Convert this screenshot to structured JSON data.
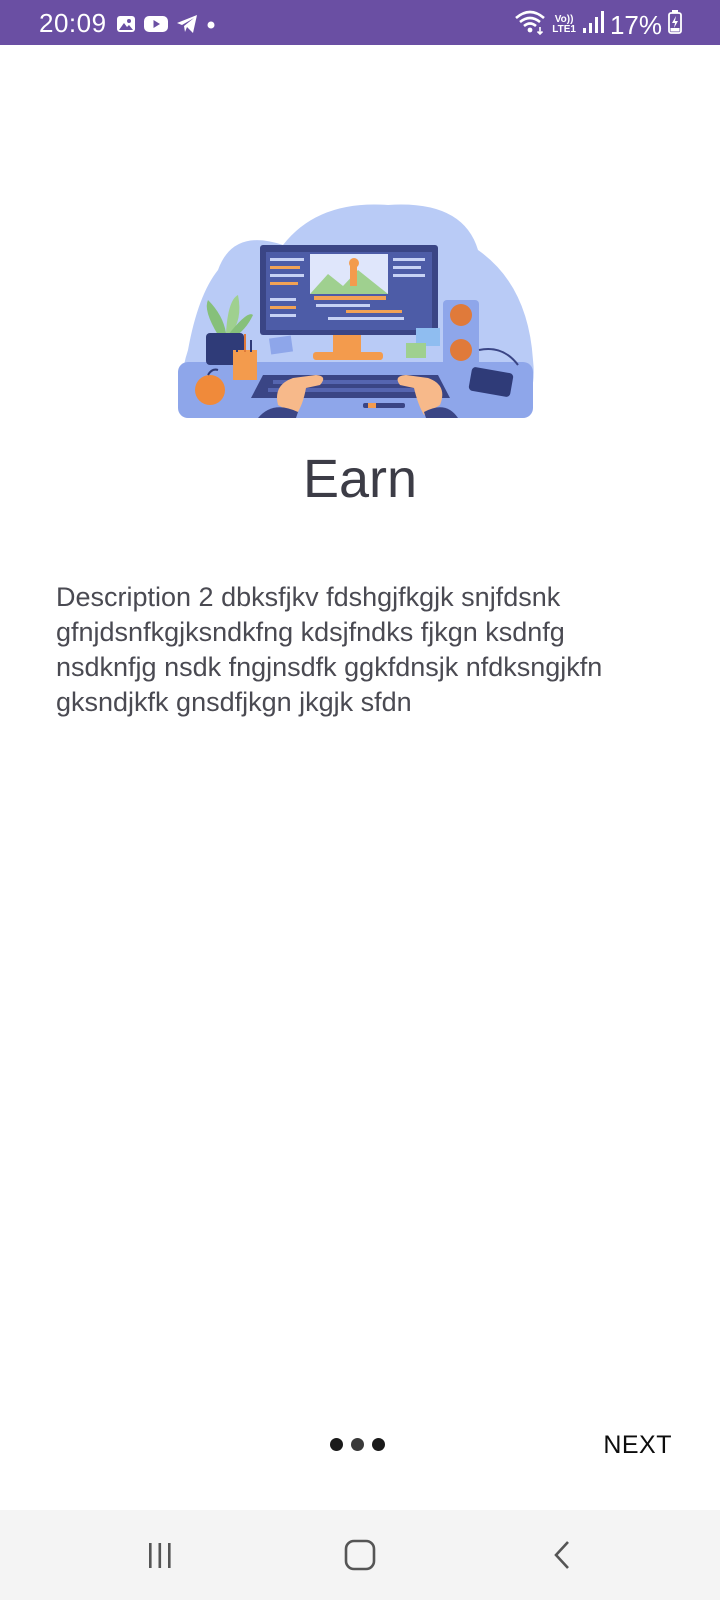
{
  "status_bar": {
    "time": "20:09",
    "battery": "17%",
    "network_label_top": "Vo))",
    "network_label_bottom": "LTE1",
    "left_icons": [
      "gallery-icon",
      "youtube-icon",
      "telegram-icon",
      "dot-icon"
    ],
    "right_icons": [
      "wifi-icon",
      "volte-icon",
      "signal-icon",
      "battery-icon"
    ],
    "background_color": "#6a4fa3"
  },
  "onboarding": {
    "title": "Earn",
    "description": "Description 2 dbksfjkv fdshgjfkgjk snjfdsnk gfnjdsnfkgjksndkfng kdsjfndks fjkgn ksdnfg nsdknfjg nsdk fngjnsdfk ggkfdnsjk nfdksngjkfn gksndjkfk gnsdfjkgn jkgjk sfdn",
    "illustration": "video-editing-desk-illustration",
    "page_count": 3,
    "next_label": "NEXT"
  },
  "nav_bar": {
    "buttons": [
      "recent-apps-icon",
      "home-icon",
      "back-icon"
    ]
  }
}
